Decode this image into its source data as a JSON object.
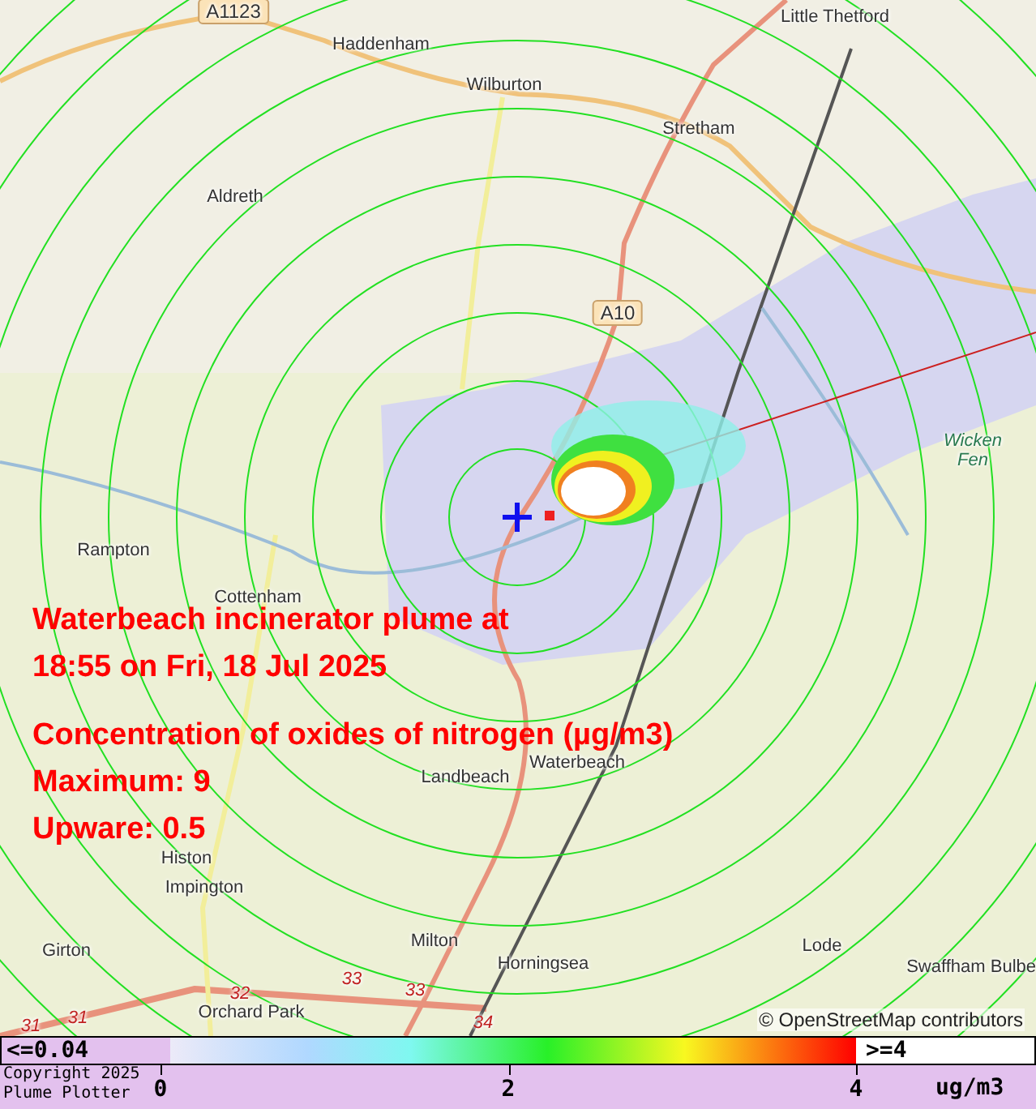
{
  "map": {
    "labels": [
      {
        "text": "A1123",
        "kind": "shield"
      },
      {
        "text": "Haddenham",
        "kind": "place"
      },
      {
        "text": "Wilburton",
        "kind": "place"
      },
      {
        "text": "Little Thetford",
        "kind": "place"
      },
      {
        "text": "Stretham",
        "kind": "place"
      },
      {
        "text": "Aldreth",
        "kind": "place"
      },
      {
        "text": "A10",
        "kind": "shield"
      },
      {
        "text": "Wicken Fen",
        "kind": "area"
      },
      {
        "text": "Rampton",
        "kind": "place"
      },
      {
        "text": "Cottenham",
        "kind": "place"
      },
      {
        "text": "Landbeach",
        "kind": "place"
      },
      {
        "text": "Waterbeach",
        "kind": "place"
      },
      {
        "text": "Histon",
        "kind": "place"
      },
      {
        "text": "Impington",
        "kind": "place"
      },
      {
        "text": "Girton",
        "kind": "place"
      },
      {
        "text": "Milton",
        "kind": "place"
      },
      {
        "text": "Horningsea",
        "kind": "place"
      },
      {
        "text": "Lode",
        "kind": "place"
      },
      {
        "text": "Swaffham Bulbe",
        "kind": "place"
      },
      {
        "text": "Orchard Park",
        "kind": "place"
      },
      {
        "text": "31",
        "kind": "road_number"
      },
      {
        "text": "31",
        "kind": "road_number"
      },
      {
        "text": "32",
        "kind": "road_number"
      },
      {
        "text": "33",
        "kind": "road_number"
      },
      {
        "text": "33",
        "kind": "road_number"
      },
      {
        "text": "34",
        "kind": "road_number"
      }
    ],
    "attribution": "© OpenStreetMap contributors"
  },
  "overlay": {
    "title_lines": [
      "Waterbeach incinerator plume at",
      "18:55 on Fri, 18 Jul 2025"
    ],
    "lines": [
      "Concentration of oxides of nitrogen (µg/m3)",
      "Maximum: 9",
      "Upware: 0.5"
    ]
  },
  "legend": {
    "low_label": "<=0.04",
    "high_label": ">=4",
    "ticks": [
      "0",
      "2",
      "4"
    ],
    "unit": "ug/m3",
    "copyright": [
      "Copyright 2025",
      "Plume Plotter"
    ]
  }
}
